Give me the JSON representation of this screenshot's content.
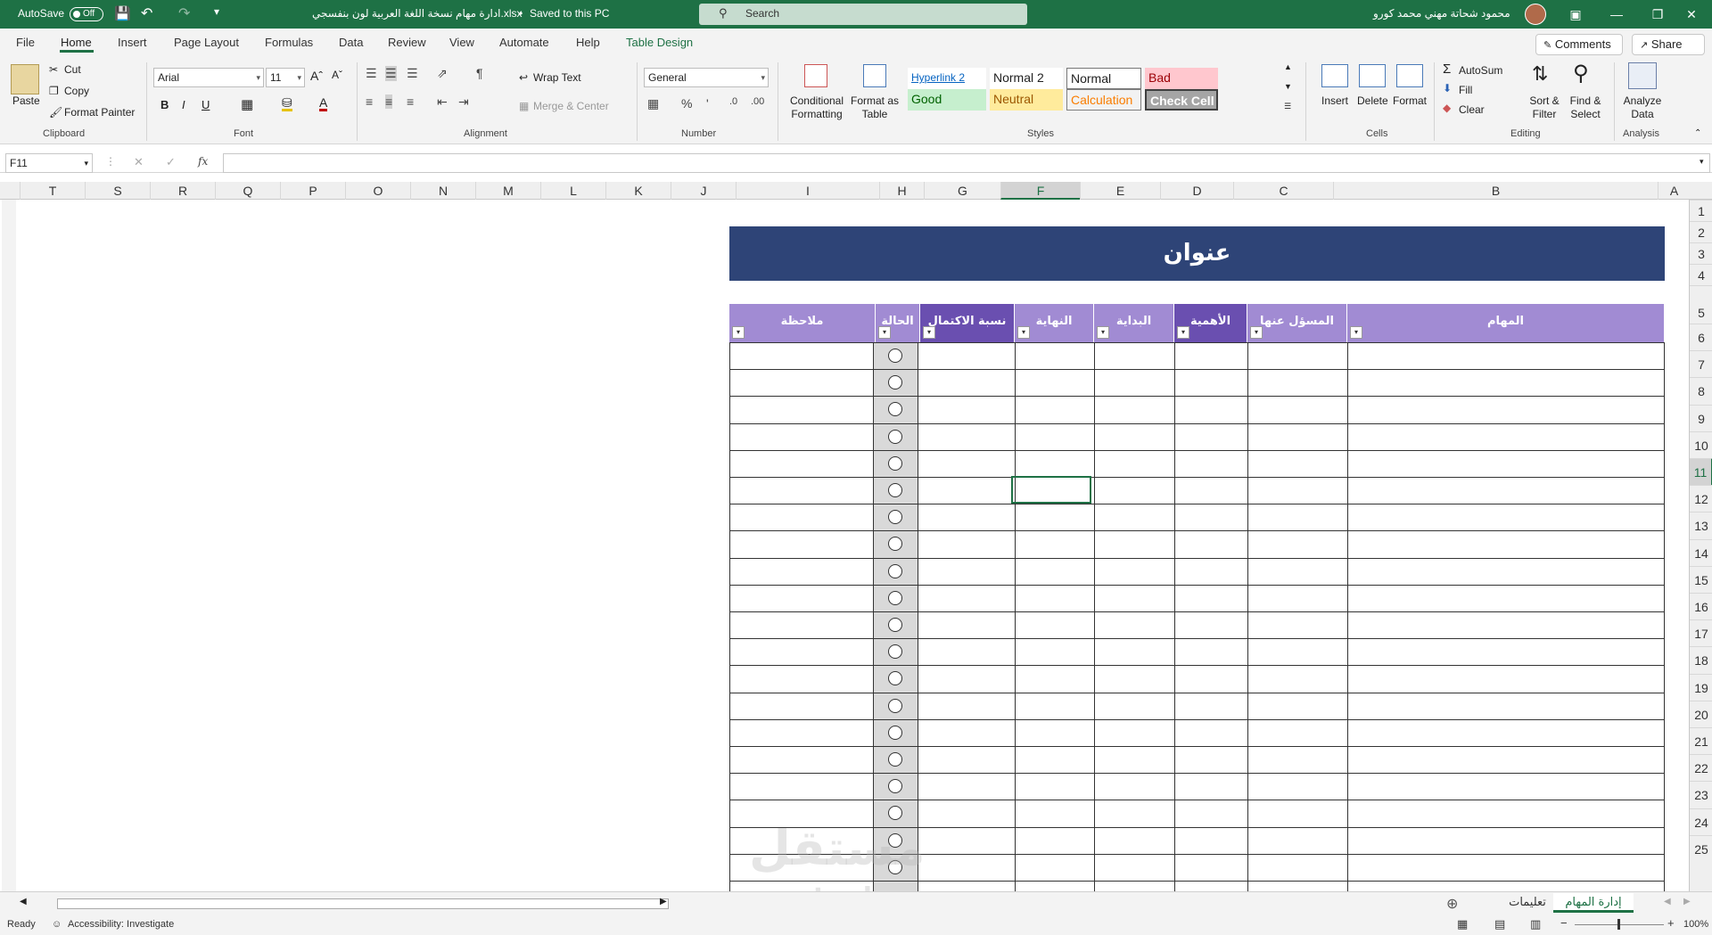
{
  "titlebar": {
    "autosave_label": "AutoSave",
    "autosave_state": "Off",
    "document_title": "ادارة مهام نسخة اللغة العربية لون بنفسجي.xlsx",
    "save_status": "Saved to this PC",
    "search_placeholder": "Search",
    "user_name": "محمود شحاتة مهني محمد كورو"
  },
  "menu": {
    "tabs": [
      "File",
      "Home",
      "Insert",
      "Page Layout",
      "Formulas",
      "Data",
      "Review",
      "View",
      "Automate",
      "Help",
      "Table Design"
    ],
    "active": "Home",
    "comments": "Comments",
    "share": "Share"
  },
  "ribbon": {
    "clipboard": {
      "paste": "Paste",
      "cut": "Cut",
      "copy": "Copy",
      "format_painter": "Format Painter",
      "label": "Clipboard"
    },
    "font": {
      "name": "Arial",
      "size": "11",
      "label": "Font",
      "bold": "B",
      "italic": "I",
      "underline": "U"
    },
    "alignment": {
      "wrap_text": "Wrap Text",
      "merge_center": "Merge & Center",
      "label": "Alignment"
    },
    "number": {
      "format": "General",
      "label": "Number"
    },
    "styles": {
      "conditional_formatting": "Conditional Formatting",
      "format_as_table": "Format as Table",
      "label": "Styles",
      "cells": [
        {
          "name": "Hyperlink 2",
          "bg": "#ffffff",
          "color": "#0563c1"
        },
        {
          "name": "Normal 2",
          "bg": "#ffffff",
          "color": "#222222"
        },
        {
          "name": "Normal",
          "bg": "#ffffff",
          "color": "#222222"
        },
        {
          "name": "Bad",
          "bg": "#ffc7ce",
          "color": "#9c0006"
        },
        {
          "name": "Good",
          "bg": "#c6efce",
          "color": "#006100"
        },
        {
          "name": "Neutral",
          "bg": "#ffeb9c",
          "color": "#9c5700"
        },
        {
          "name": "Calculation",
          "bg": "#f2f2f2",
          "color": "#fa7d00"
        },
        {
          "name": "Check Cell",
          "bg": "#a5a5a5",
          "color": "#ffffff"
        }
      ]
    },
    "cells": {
      "insert": "Insert",
      "delete": "Delete",
      "format": "Format",
      "label": "Cells"
    },
    "editing": {
      "autosum": "AutoSum",
      "fill": "Fill",
      "clear": "Clear",
      "sort_filter": "Sort & Filter",
      "find_select": "Find & Select",
      "label": "Editing"
    },
    "analysis": {
      "analyze_data": "Analyze Data",
      "label": "Analysis"
    }
  },
  "formula_bar": {
    "name_box": "F11",
    "fx": "fx",
    "value": ""
  },
  "grid": {
    "columns": [
      "T",
      "S",
      "R",
      "Q",
      "P",
      "O",
      "N",
      "M",
      "L",
      "K",
      "J",
      "I",
      "H",
      "G",
      "F",
      "E",
      "D",
      "C",
      "B",
      "A"
    ],
    "selected_column": "F",
    "rows": [
      "1",
      "2",
      "3",
      "4",
      "5",
      "6",
      "7",
      "8",
      "9",
      "10",
      "11",
      "12",
      "13",
      "14",
      "15",
      "16",
      "17",
      "18",
      "19",
      "20",
      "21",
      "22",
      "23",
      "24",
      "25"
    ],
    "selected_row": "11"
  },
  "table": {
    "title": "عنوان",
    "headers": [
      "المهام",
      "المسؤل عنها",
      "الأهمية",
      "البداية",
      "النهاية",
      "نسبة الاكتمال",
      "الحالة",
      "ملاحظة"
    ]
  },
  "sheets": {
    "tabs": [
      "إدارة المهام",
      "تعليمات"
    ],
    "active": "إدارة المهام"
  },
  "status": {
    "ready": "Ready",
    "accessibility": "Accessibility: Investigate",
    "zoom": "100%"
  },
  "watermark": {
    "line1": "مستقل",
    "line2": "mostaql.com"
  }
}
